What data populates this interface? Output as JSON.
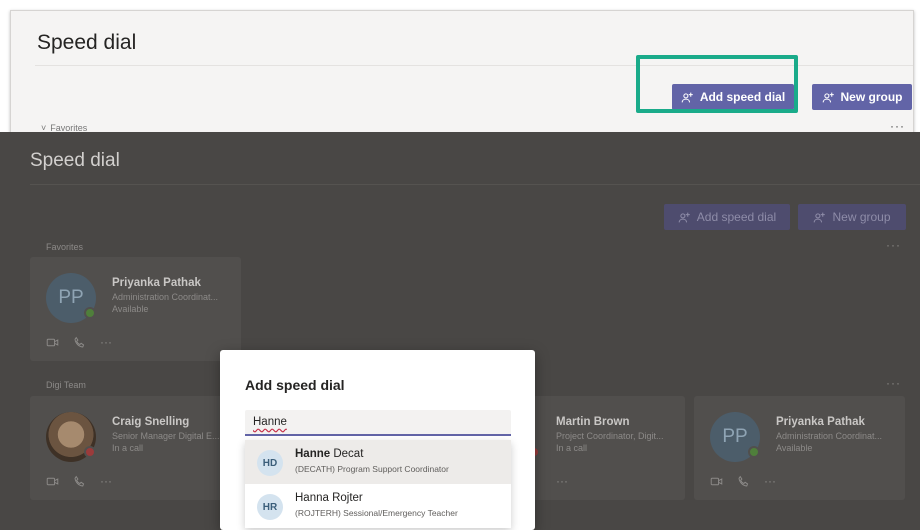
{
  "top_panel": {
    "title": "Speed dial",
    "add_speed_dial": "Add speed dial",
    "new_group": "New group",
    "favorites_label": "Favorites",
    "more": "···",
    "highlight_color": "#1aab8a"
  },
  "background": {
    "title": "Speed dial",
    "add_speed_dial": "Add speed dial",
    "new_group": "New group",
    "favorites_label": "Favorites",
    "digi_team_label": "Digi Team",
    "more": "···",
    "favorites": [
      {
        "initials": "PP",
        "name": "Priyanka Pathak",
        "role": "Administration Coordinat...",
        "status": "Available"
      }
    ],
    "digi_team": [
      {
        "initials": "",
        "name": "Craig Snelling",
        "role": "Senior Manager Digital E...",
        "status": "In a call"
      },
      {
        "initials": "",
        "name": "Martin Brown",
        "role": "Project Coordinator, Digit...",
        "status": "In a call"
      },
      {
        "initials": "PP",
        "name": "Priyanka Pathak",
        "role": "Administration Coordinat...",
        "status": "Available"
      }
    ],
    "card_more": "···"
  },
  "dialog": {
    "title": "Add speed dial",
    "search_value": "Hanne",
    "suggestions": [
      {
        "initials": "HD",
        "name_bold": "Hanne",
        "name_rest": " Decat",
        "subtitle": "(DECATH) Program Support Coordinator"
      },
      {
        "initials": "HR",
        "name_bold": "",
        "name_rest": "Hanna Rojter",
        "subtitle": "(ROJTERH) Sessional/Emergency Teacher"
      }
    ]
  },
  "colors": {
    "brand": "#6264a7",
    "available": "#92c353",
    "busy": "#c4314b"
  }
}
